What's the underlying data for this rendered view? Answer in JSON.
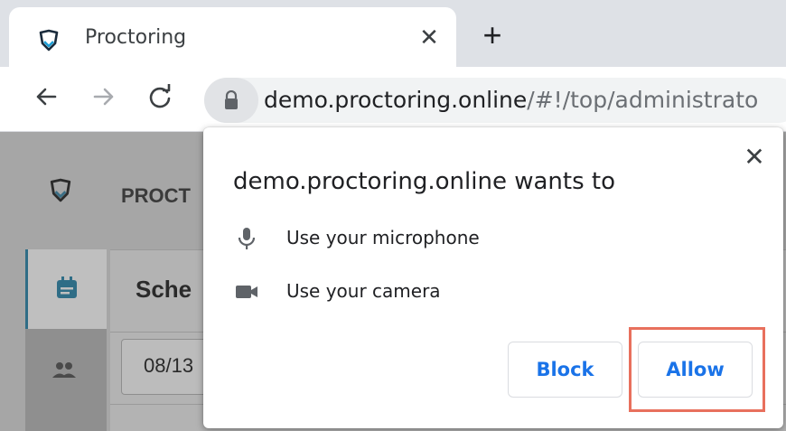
{
  "browser": {
    "tab": {
      "title": "Proctoring",
      "close_glyph": "✕"
    },
    "new_tab_glyph": "+",
    "address": {
      "host": "demo.proctoring.online",
      "path": "/#!/top/administrato"
    }
  },
  "page": {
    "brand": "PROCT",
    "section_title": "Sche",
    "date_value": "08/13"
  },
  "dialog": {
    "title": "demo.proctoring.online wants to",
    "close_glyph": "✕",
    "permissions": [
      {
        "icon": "microphone-icon",
        "label": "Use your microphone"
      },
      {
        "icon": "camera-icon",
        "label": "Use your camera"
      }
    ],
    "block_label": "Block",
    "allow_label": "Allow"
  },
  "colors": {
    "accent": "#1a73e8",
    "highlight": "#e8705d",
    "overlay": "#a6a6a6"
  }
}
